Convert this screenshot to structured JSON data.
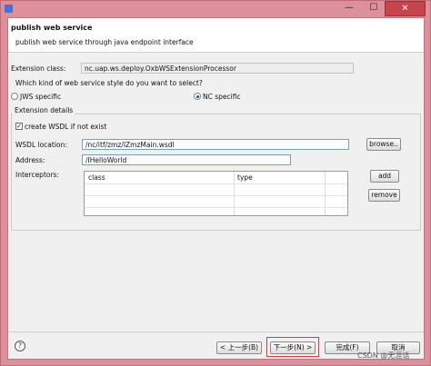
{
  "window": {
    "minimize_symbol": "—",
    "maximize_symbol": "☐",
    "close_symbol": "✕"
  },
  "banner": {
    "title": "publish web service",
    "description": "publish web service through java endpoint interface"
  },
  "form": {
    "extension_class_label": "Extension class:",
    "extension_class_value": "nc.uap.ws.deploy.OxbWSExtensionProcessor",
    "style_question": "Which kind of web service style do you want to select?",
    "style_options": [
      "JWS specific",
      "NC specific"
    ],
    "style_selected": "NC specific"
  },
  "extension_details": {
    "group_title": "Extension details",
    "create_wsdl_label": "create WSDL if not exist",
    "create_wsdl_checked": true,
    "wsdl_location_label": "WSDL location:",
    "wsdl_location_value": "/nc/itf/zmz/IZmzMain.wsdl",
    "browse_label": "browse..",
    "address_label": "Address:",
    "address_value": "/IHelloWorld",
    "interceptors_label": "Interceptors:",
    "interceptors_columns": [
      "class",
      "type"
    ],
    "add_label": "add",
    "remove_label": "remove"
  },
  "footer": {
    "help_symbol": "?",
    "back_label": "< 上一步(B)",
    "next_label": "下一步(N) >",
    "finish_label": "完成(F)",
    "cancel_label": "取消"
  },
  "watermark": "CSDN @无涯话"
}
